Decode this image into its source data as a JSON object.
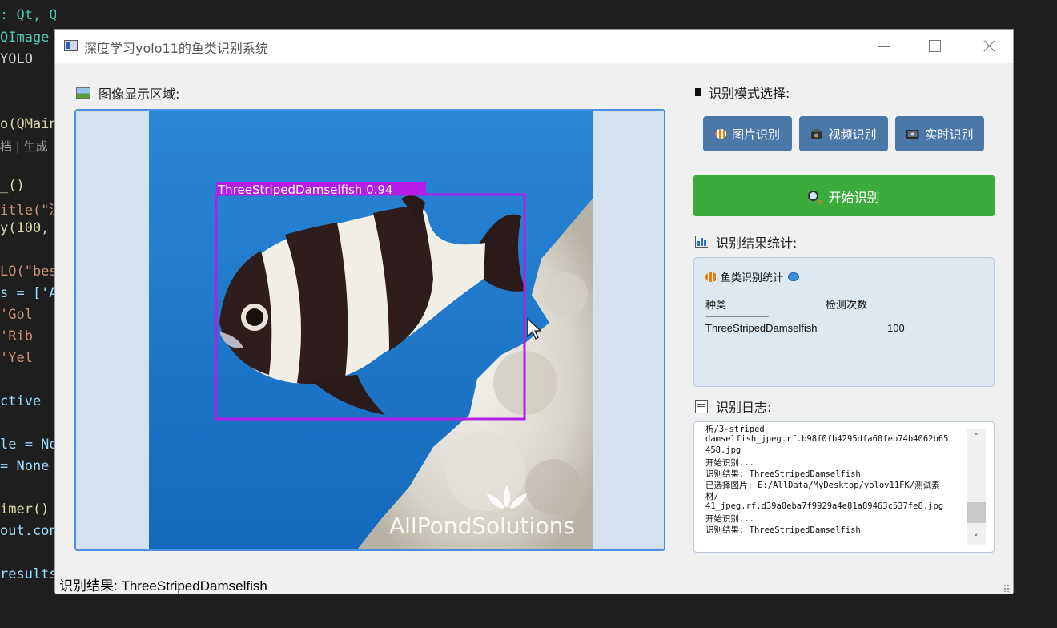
{
  "editor": {
    "lines": [
      {
        "text": ": Qt, QTimer",
        "cls": "kw"
      },
      {
        "text": " QImage",
        "cls": "kw"
      },
      {
        "text": " YOLO",
        "cls": ""
      },
      {
        "text": "o(QMain",
        "cls": "fn"
      },
      {
        "text": "档 | 生成",
        "cls": "cm"
      },
      {
        "text": "_()",
        "cls": "fn"
      },
      {
        "text": "itle(\"深",
        "cls": "str"
      },
      {
        "text": "y(100,",
        "cls": "fn"
      },
      {
        "text": "LO(\"bes",
        "cls": "str"
      },
      {
        "text": "s = ['A",
        "cls": "var"
      },
      {
        "text": "  'Gol",
        "cls": "str"
      },
      {
        "text": "  'Rib",
        "cls": "str"
      },
      {
        "text": "  'Yel",
        "cls": "str"
      },
      {
        "text": "ctive",
        "cls": "var"
      },
      {
        "text": "le = No",
        "cls": "var"
      },
      {
        "text": " = None",
        "cls": "var"
      },
      {
        "text": "imer()",
        "cls": "fn"
      },
      {
        "text": "out.con",
        "cls": "var"
      },
      {
        "text": "results",
        "cls": "var"
      }
    ]
  },
  "window": {
    "title": "深度学习yolo11的鱼类识别系统"
  },
  "image_panel": {
    "label": "图像显示区域:",
    "detection_label": "ThreeStripedDamselfish  0.94",
    "watermark": "AllPondSolutions",
    "colors": {
      "box": "#b41ee6",
      "water": "#1f7fd0"
    }
  },
  "mode": {
    "label": "识别模式选择:",
    "buttons": [
      {
        "label": "图片识别",
        "icon": "fish-icon"
      },
      {
        "label": "视频识别",
        "icon": "camera-icon"
      },
      {
        "label": "实时识别",
        "icon": "webcam-icon"
      }
    ],
    "start_label": "开始识别"
  },
  "stats": {
    "label": "识别结果统计:",
    "box_title": "鱼类识别统计",
    "col_species": "种类",
    "col_count": "检测次数",
    "separator": "------------------------------",
    "rows": [
      {
        "species": "ThreeStripedDamselfish",
        "count": "100"
      }
    ]
  },
  "log": {
    "label": "识别日志:",
    "lines": [
      "析/3-striped",
      "damselfish_jpeg.rf.b98f0fb4295dfa60feb74b4062b65",
      "458.jpg",
      "开始识别...",
      "识别结果: ThreeStripedDamselfish",
      "已选择图片: E:/AllData/MyDesktop/yolov11FK/测试素",
      "材/",
      "41_jpeg.rf.d39a0eba7f9929a4e81a89463c537fe8.jpg",
      "开始识别...",
      "识别结果: ThreeStripedDamselfish"
    ]
  },
  "status": {
    "result": "识别结果: ThreeStripedDamselfish"
  }
}
